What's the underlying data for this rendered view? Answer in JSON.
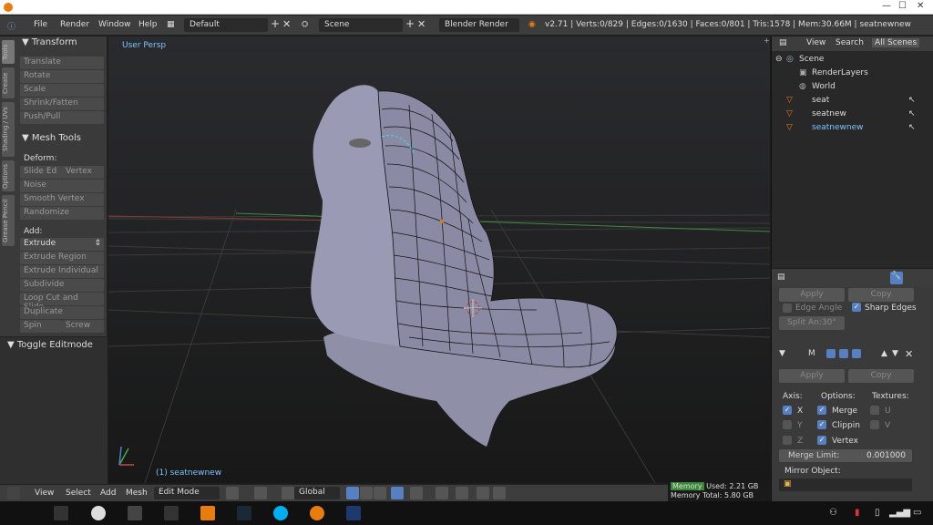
{
  "info_bar": {
    "menus": [
      "File",
      "Render",
      "Window",
      "Help"
    ],
    "screen_layout": "Default",
    "scene": "Scene",
    "render_engine": "Blender Render",
    "stats": "v2.71 | Verts:0/829 | Edges:0/1630 | Faces:0/801 | Tris:1578 | Mem:30.66M | seatnewnew"
  },
  "toolshelf": {
    "vertical_tabs": [
      "Tools",
      "Create",
      "Shading / UVs",
      "Options",
      "Grease Pencil"
    ],
    "transform": {
      "header": "Transform",
      "buttons": [
        "Translate",
        "Rotate",
        "Scale",
        "Shrink/Fatten",
        "Push/Pull"
      ]
    },
    "mesh_tools": {
      "header": "Mesh Tools",
      "deform_label": "Deform:",
      "slide_edge": "Slide Ed",
      "vertex": "Vertex",
      "deform_buttons": [
        "Noise",
        "Smooth Vertex",
        "Randomize"
      ],
      "add_label": "Add:",
      "extrude": "Extrude",
      "add_buttons": [
        "Extrude Region",
        "Extrude Individual",
        "Subdivide",
        "Loop Cut and Slide",
        "Duplicate"
      ],
      "spin": "Spin",
      "screw": "Screw"
    }
  },
  "toggle_panel": {
    "header": "Toggle Editmode"
  },
  "viewport": {
    "label": "User Persp",
    "object_label": "(1) seatnewnew"
  },
  "bottom_bar": {
    "menus": [
      "View",
      "Select",
      "Add",
      "Mesh"
    ],
    "mode": "Edit Mode",
    "orientation": "Global"
  },
  "memory": {
    "label": "Memory",
    "used": "Used: 2.21 GB",
    "total": "Memory Total: 5.80 GB"
  },
  "outliner": {
    "tabs": [
      "View",
      "Search",
      "All Scenes"
    ],
    "rows": [
      {
        "name": "Scene",
        "icon": "scene-icon"
      },
      {
        "name": "RenderLayers",
        "icon": "render-layers-icon"
      },
      {
        "name": "World",
        "icon": "world-icon"
      },
      {
        "name": "seat",
        "icon": "mesh-icon"
      },
      {
        "name": "seatnew",
        "icon": "mesh-icon"
      },
      {
        "name": "seatnewnew",
        "icon": "mesh-icon",
        "selected": true
      }
    ]
  },
  "properties": {
    "top_apply": "Apply",
    "top_copy": "Copy",
    "edge_angle": "Edge Angle",
    "sharp_edges": "Sharp Edges",
    "split_angle": "Split An:30°",
    "modifier_m": "M",
    "apply": "Apply",
    "copy": "Copy",
    "axis_label": "Axis:",
    "options_label": "Options:",
    "textures_label": "Textures:",
    "axes": [
      "X",
      "Y",
      "Z"
    ],
    "options": [
      "Merge",
      "Clippin",
      "Vertex"
    ],
    "textures": [
      "U",
      "V"
    ],
    "merge_limit_label": "Merge Limit:",
    "merge_limit_value": "0.001000",
    "mirror_object_label": "Mirror Object:"
  },
  "colors": {
    "accent": "#5680c2",
    "selection": "#7ec4ff",
    "blender_orange": "#e87d0d"
  }
}
